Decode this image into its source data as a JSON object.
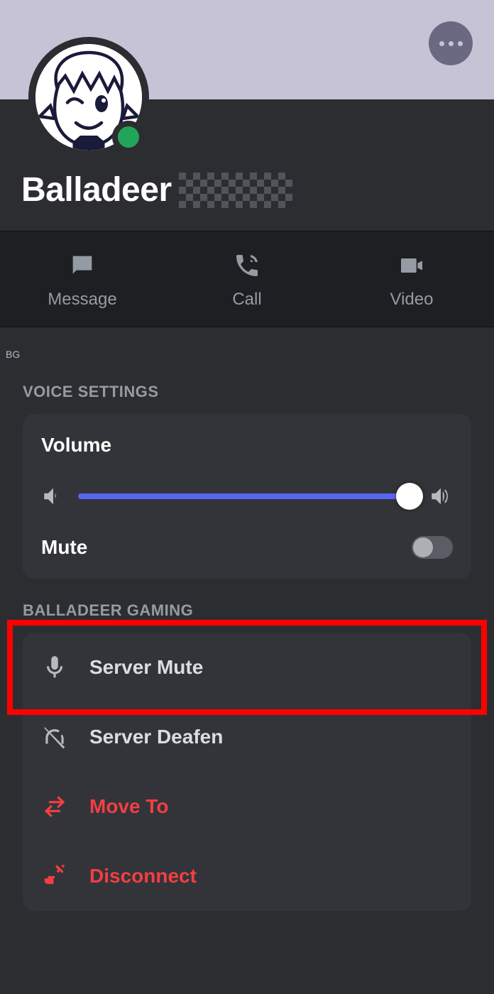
{
  "profile": {
    "username": "Balladeer",
    "status": "online",
    "status_color": "#23a559"
  },
  "actions": {
    "message": "Message",
    "call": "Call",
    "video": "Video"
  },
  "badge_tag": "BG",
  "voice_settings": {
    "title": "VOICE SETTINGS",
    "volume_label": "Volume",
    "volume_percent": 100,
    "mute_label": "Mute",
    "mute_on": false
  },
  "server_section": {
    "title": "BALLADEER GAMING",
    "items": [
      {
        "icon": "microphone-icon",
        "label": "Server Mute",
        "danger": false
      },
      {
        "icon": "headphones-slash-icon",
        "label": "Server Deafen",
        "danger": false
      },
      {
        "icon": "arrows-swap-icon",
        "label": "Move To",
        "danger": true
      },
      {
        "icon": "disconnect-icon",
        "label": "Disconnect",
        "danger": true
      }
    ]
  },
  "highlight": {
    "target": "server-mute-item"
  },
  "colors": {
    "banner": "#c7c3d6",
    "accent": "#5865f2",
    "danger": "#f23f42",
    "online": "#23a559"
  }
}
